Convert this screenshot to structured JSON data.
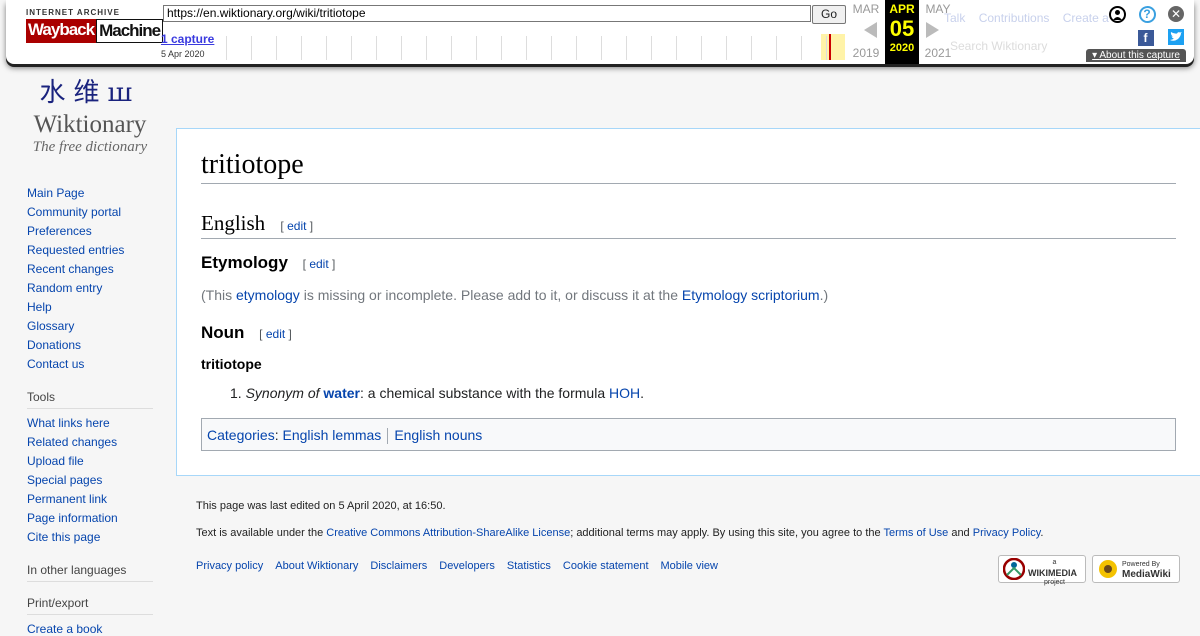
{
  "wayback": {
    "logo_top": "INTERNET ARCHIVE",
    "logo_way": "Wayback",
    "logo_machine": "Machine",
    "url": "https://en.wiktionary.org/wiki/tritiotope",
    "go_label": "Go",
    "captures_label": "1 capture",
    "capture_date": "5 Apr 2020",
    "prev_month": "MAR",
    "cur_month": "APR",
    "next_month": "MAY",
    "cur_day": "05",
    "prev_year": "2019",
    "cur_year": "2020",
    "next_year": "2021",
    "about_label": "About this capture",
    "icons": {
      "user": "user-icon",
      "help": "help-icon",
      "close": "close-icon",
      "facebook": "facebook-icon",
      "twitter": "twitter-icon"
    }
  },
  "personal_tools": {
    "talk": "Talk",
    "contributions": "Contributions",
    "create_account": "Create a"
  },
  "search": {
    "placeholder": "Search Wiktionary"
  },
  "logo": {
    "glyphs": "水维ꟺ",
    "name": "Wiktionary",
    "tagline": "The free dictionary"
  },
  "sidebar": {
    "nav": [
      "Main Page",
      "Community portal",
      "Preferences",
      "Requested entries",
      "Recent changes",
      "Random entry",
      "Help",
      "Glossary",
      "Donations",
      "Contact us"
    ],
    "tools_heading": "Tools",
    "tools": [
      "What links here",
      "Related changes",
      "Upload file",
      "Special pages",
      "Permanent link",
      "Page information",
      "Cite this page"
    ],
    "languages_heading": "In other languages",
    "print_heading": "Print/export",
    "print_first": "Create a book"
  },
  "article": {
    "title": "tritiotope",
    "lang_heading": "English",
    "edit_label": "edit",
    "etymology_heading": "Etymology",
    "ety_pre": "(This ",
    "ety_link1": "etymology",
    "ety_mid": " is missing or incomplete. Please add to it, or discuss it at the ",
    "ety_link2": "Etymology scriptorium",
    "ety_post": ".)",
    "noun_heading": "Noun",
    "headword": "tritiotope",
    "def_num": "1.",
    "def_syn": "Synonym of",
    "def_link": "water",
    "def_text": ": a chemical substance with the formula ",
    "def_formula": "HOH",
    "def_end": ".",
    "categories_label": "Categories",
    "categories": [
      "English lemmas",
      "English nouns"
    ]
  },
  "footer": {
    "last_edited": "This page was last edited on 5 April 2020, at 16:50.",
    "license_pre": "Text is available under the ",
    "license_link": "Creative Commons Attribution-ShareAlike License",
    "license_mid": "; additional terms may apply. By using this site, you agree to the ",
    "terms_link": "Terms of Use",
    "and": " and ",
    "privacy_link": "Privacy Policy",
    "end": ".",
    "links": [
      "Privacy policy",
      "About Wiktionary",
      "Disclaimers",
      "Developers",
      "Statistics",
      "Cookie statement",
      "Mobile view"
    ],
    "badge_wikimedia_small": "a",
    "badge_wikimedia": "WIKIMEDIA",
    "badge_wikimedia_sub": "project",
    "badge_mediawiki_small": "Powered By",
    "badge_mediawiki": "MediaWiki"
  }
}
